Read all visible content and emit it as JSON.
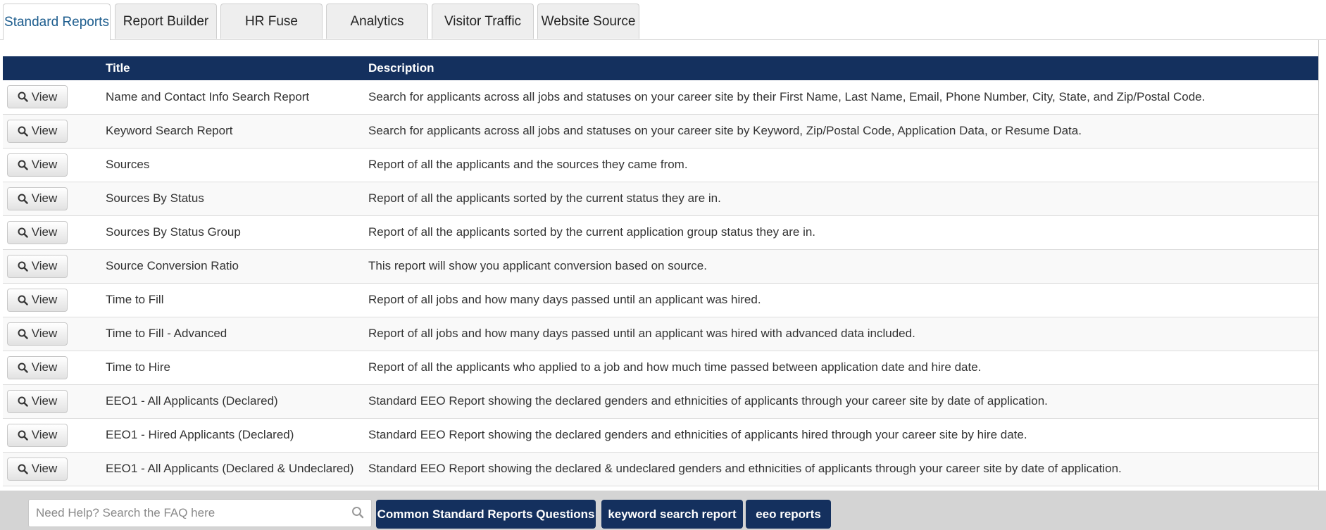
{
  "tabs": [
    {
      "label": "Standard Reports",
      "active": true
    },
    {
      "label": "Report Builder",
      "active": false
    },
    {
      "label": "HR Fuse",
      "active": false
    },
    {
      "label": "Analytics",
      "active": false
    },
    {
      "label": "Visitor Traffic",
      "active": false
    },
    {
      "label": "Website Source",
      "active": false
    }
  ],
  "table": {
    "columns": [
      "",
      "Title",
      "Description"
    ],
    "view_label": "View",
    "rows": [
      {
        "title": "Name and Contact Info Search Report",
        "description": "Search for applicants across all jobs and statuses on your career site by their First Name, Last Name, Email, Phone Number, City, State, and Zip/Postal Code."
      },
      {
        "title": "Keyword Search Report",
        "description": "Search for applicants across all jobs and statuses on your career site by Keyword, Zip/Postal Code, Application Data, or Resume Data."
      },
      {
        "title": "Sources",
        "description": "Report of all the applicants and the sources they came from."
      },
      {
        "title": "Sources By Status",
        "description": "Report of all the applicants sorted by the current status they are in."
      },
      {
        "title": "Sources By Status Group",
        "description": "Report of all the applicants sorted by the current application group status they are in."
      },
      {
        "title": "Source Conversion Ratio",
        "description": "This report will show you applicant conversion based on source."
      },
      {
        "title": "Time to Fill",
        "description": "Report of all jobs and how many days passed until an applicant was hired."
      },
      {
        "title": "Time to Fill - Advanced",
        "description": "Report of all jobs and how many days passed until an applicant was hired with advanced data included."
      },
      {
        "title": "Time to Hire",
        "description": "Report of all the applicants who applied to a job and how much time passed between application date and hire date."
      },
      {
        "title": "EEO1 - All Applicants (Declared)",
        "description": "Standard EEO Report showing the declared genders and ethnicities of applicants through your career site by date of application."
      },
      {
        "title": "EEO1 - Hired Applicants (Declared)",
        "description": "Standard EEO Report showing the declared genders and ethnicities of applicants hired through your career site by hire date."
      },
      {
        "title": "EEO1 - All Applicants (Declared & Undeclared)",
        "description": "Standard EEO Report showing the declared & undeclared genders and ethnicities of applicants through your career site by date of application."
      }
    ]
  },
  "footer": {
    "search_placeholder": "Need Help? Search the FAQ here",
    "search_value": "",
    "buttons": [
      "Common Standard Reports Questions",
      "keyword search report",
      "eeo reports"
    ]
  },
  "colors": {
    "header_bg": "#14305e",
    "active_tab_text": "#1d5d8e",
    "footer_bg": "#d4d4d4"
  }
}
